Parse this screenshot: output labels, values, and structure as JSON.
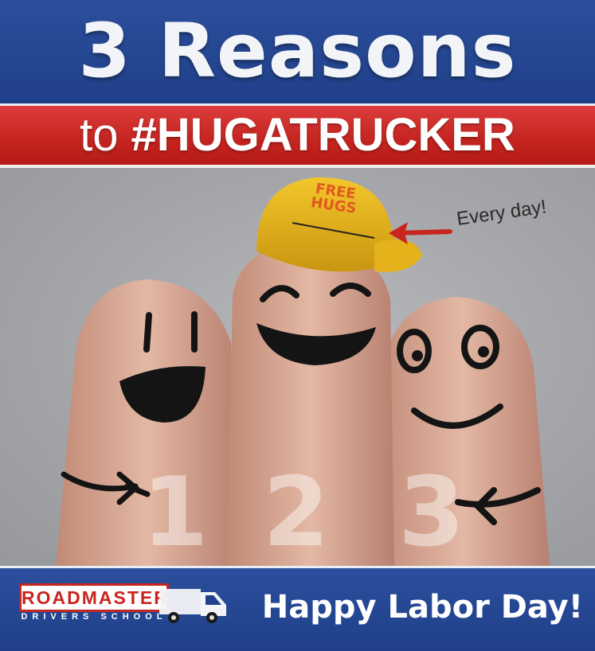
{
  "headline": "3 Reasons",
  "subline": {
    "prefix": "to",
    "hashtag": "#HUGATRUCKER"
  },
  "hat": {
    "line1": "FREE",
    "line2": "HUGS"
  },
  "callout": "Every day!",
  "fingers": [
    "1",
    "2",
    "3"
  ],
  "logo": {
    "word": "ROADMASTER",
    "sub": "DRIVERS SCHOOL",
    "icon": "truck-icon"
  },
  "footer": "Happy Labor Day!",
  "colors": {
    "blue": "#243f8c",
    "red": "#c8251f",
    "hat": "#e8b417"
  }
}
